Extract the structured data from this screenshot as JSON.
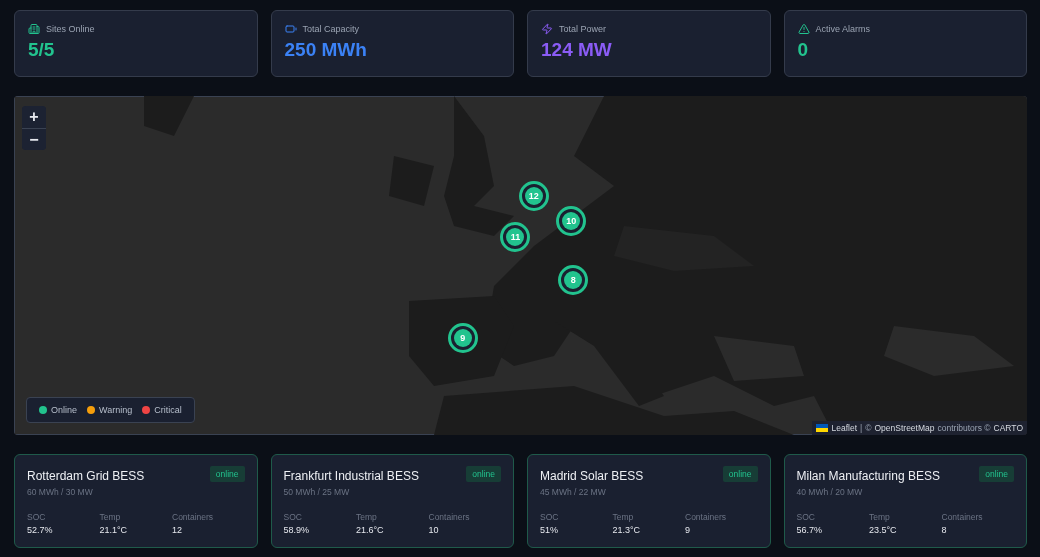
{
  "stats": [
    {
      "kind": "sites",
      "label": "Sites Online",
      "value": "5/5"
    },
    {
      "kind": "capacity",
      "label": "Total Capacity",
      "value": "250 MWh"
    },
    {
      "kind": "power",
      "label": "Total Power",
      "value": "124 MW"
    },
    {
      "kind": "alarms",
      "label": "Active Alarms",
      "value": "0"
    }
  ],
  "map": {
    "kind": "picture",
    "zoom_controls": [
      "+",
      "−"
    ],
    "markers": [
      {
        "label": "12",
        "color": "#22c38e"
      },
      {
        "label": "10",
        "color": "#22c38e"
      },
      {
        "label": "11",
        "color": "#22c38e"
      },
      {
        "label": "9",
        "color": "#22c38e"
      },
      {
        "label": "8",
        "color": "#22c38e"
      }
    ],
    "legend": [
      {
        "label": "Online",
        "color": "#22c38e"
      },
      {
        "label": "Warning",
        "color": "#f59e0b"
      },
      {
        "label": "Critical",
        "color": "#ef4444"
      }
    ],
    "attribution": [
      {
        "kind": "link",
        "text": "Leaflet"
      },
      {
        "kind": "text",
        "text": "|"
      },
      {
        "kind": "text",
        "text": "©"
      },
      {
        "kind": "link",
        "text": "OpenStreetMap"
      },
      {
        "kind": "text",
        "text": "contributors ©"
      },
      {
        "kind": "link",
        "text": "CARTO"
      }
    ]
  },
  "sites": [
    {
      "name": "Rotterdam Grid BESS",
      "status": "online",
      "spec": "60 MWh / 30 MW",
      "metrics": [
        {
          "label": "SOC",
          "value": "52.7%"
        },
        {
          "label": "Temp",
          "value": "21.1°C"
        },
        {
          "label": "Containers",
          "value": "12"
        }
      ]
    },
    {
      "name": "Frankfurt Industrial BESS",
      "status": "online",
      "spec": "50 MWh / 25 MW",
      "metrics": [
        {
          "label": "SOC",
          "value": "58.9%"
        },
        {
          "label": "Temp",
          "value": "21.6°C"
        },
        {
          "label": "Containers",
          "value": "10"
        }
      ]
    },
    {
      "name": "Madrid Solar BESS",
      "status": "online",
      "spec": "45 MWh / 22 MW",
      "metrics": [
        {
          "label": "SOC",
          "value": "51%"
        },
        {
          "label": "Temp",
          "value": "21.3°C"
        },
        {
          "label": "Containers",
          "value": "9"
        }
      ]
    },
    {
      "name": "Milan Manufacturing BESS",
      "status": "online",
      "spec": "40 MWh / 20 MW",
      "metrics": [
        {
          "label": "SOC",
          "value": "56.7%"
        },
        {
          "label": "Temp",
          "value": "23.5°C"
        },
        {
          "label": "Containers",
          "value": "8"
        }
      ]
    }
  ]
}
